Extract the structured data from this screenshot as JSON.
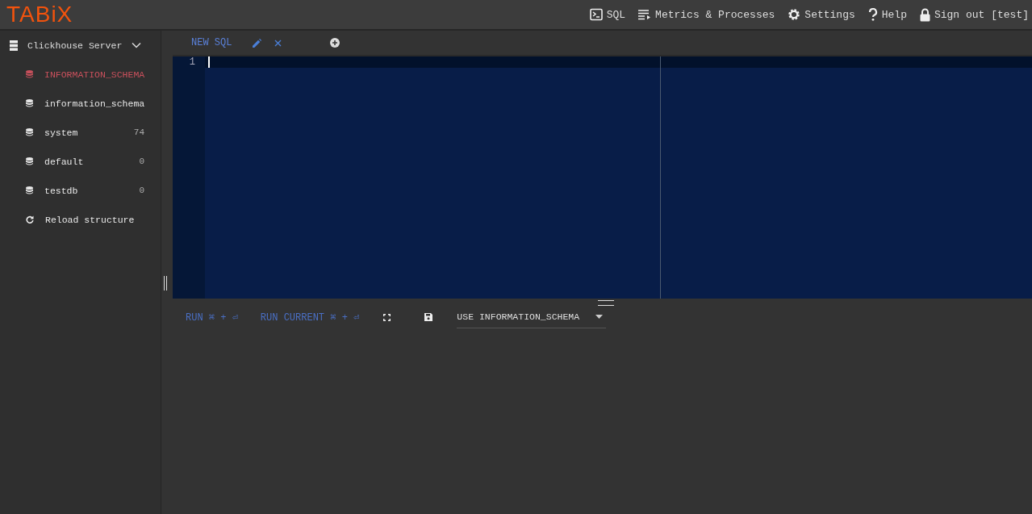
{
  "logo": "TABiX",
  "nav": [
    {
      "kind": "sql",
      "label": "SQL"
    },
    {
      "kind": "metrics",
      "label": "Metrics & Processes"
    },
    {
      "kind": "settings",
      "label": "Settings"
    },
    {
      "kind": "help",
      "label": "Help"
    },
    {
      "kind": "signout",
      "label": "Sign out [test]"
    }
  ],
  "sidebar": {
    "server": "Clickhouse Server",
    "expanded": true,
    "databases": [
      {
        "name": "INFORMATION_SCHEMA",
        "selected": true
      },
      {
        "name": "information_schema",
        "selected": false
      },
      {
        "name": "system",
        "count": "74",
        "selected": false
      },
      {
        "name": "default",
        "count": "0",
        "selected": false
      },
      {
        "name": "testdb",
        "count": "0",
        "selected": false
      }
    ],
    "reload": "Reload structure"
  },
  "tabs": [
    {
      "label": "NEW SQL",
      "selected": true
    }
  ],
  "editor": {
    "line_numbers": [
      "1"
    ]
  },
  "toolbar": {
    "run": "RUN ⌘ + ⏎",
    "run_current": "RUN CURRENT ⌘ + ⏎",
    "database_select": "USE INFORMATION_SCHEMA"
  }
}
